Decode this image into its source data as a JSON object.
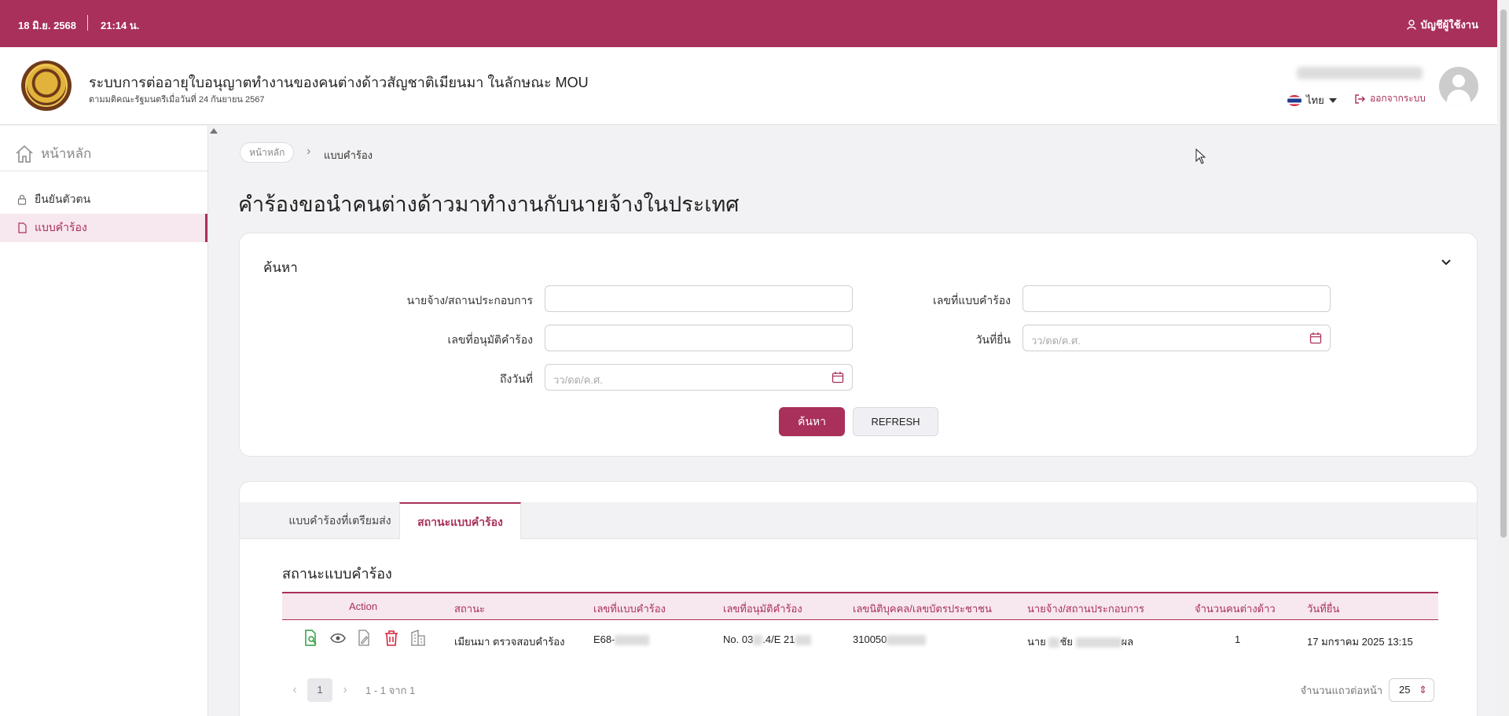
{
  "topbar": {
    "date": "18 มิ.ย. 2568",
    "time": "21:14 น.",
    "account_label": "บัญชีผู้ใช้งาน"
  },
  "header": {
    "title": "ระบบการต่ออายุใบอนุญาตทำงานของคนต่างด้าวสัญชาติเมียนมา ในลักษณะ MOU",
    "subtitle": "ตามมติคณะรัฐมนตรีเมื่อวันที่ 24 กันยายน 2567",
    "language": "ไทย",
    "logout": "ออกจากระบบ"
  },
  "sidebar": {
    "home": "หน้าหลัก",
    "items": [
      {
        "label": "ยืนยันตัวตน",
        "icon": "lock-icon"
      },
      {
        "label": "แบบคำร้อง",
        "icon": "document-icon"
      }
    ]
  },
  "breadcrumb": {
    "home": "หน้าหลัก",
    "current": "แบบคำร้อง"
  },
  "page_title": "คำร้องขอนำคนต่างด้าวมาทำงานกับนายจ้างในประเทศ",
  "search": {
    "title": "ค้นหา",
    "fields": {
      "employer": {
        "label": "นายจ้าง/สถานประกอบการ",
        "value": ""
      },
      "request_no": {
        "label": "เลขที่แบบคำร้อง",
        "value": ""
      },
      "approval_no": {
        "label": "เลขที่อนุมัติคำร้อง",
        "value": ""
      },
      "submit_date": {
        "label": "วันที่ยื่น",
        "placeholder": "วว/ดด/ค.ศ."
      },
      "to_date": {
        "label": "ถึงวันที่",
        "placeholder": "วว/ดด/ค.ศ."
      }
    },
    "search_button": "ค้นหา",
    "refresh_button": "REFRESH"
  },
  "tabs": [
    {
      "label": "แบบคำร้องที่เตรียมส่ง"
    },
    {
      "label": "สถานะแบบคำร้อง"
    }
  ],
  "table": {
    "title": "สถานะแบบคำร้อง",
    "columns": [
      "Action",
      "สถานะ",
      "เลขที่แบบคำร้อง",
      "เลขที่อนุมัติคำร้อง",
      "เลขนิติบุคคล/เลขบัตรประชาชน",
      "นายจ้าง/สถานประกอบการ",
      "จำนวนคนต่างด้าว",
      "วันที่ยื่น"
    ],
    "rows": [
      {
        "status": "เมียนมา ตรวจสอบคำร้อง",
        "request_no": "E68-",
        "approval_no_a": "No. 03",
        "approval_no_b": ".4/E 21",
        "juristic_id": "310050",
        "employer_a": "นาย",
        "employer_b": "ชัย",
        "employer_c": "ผล",
        "worker_count": "1",
        "submit_date": "17 มกราคม 2025 13:15"
      }
    ]
  },
  "pagination": {
    "page": "1",
    "info": "1 - 1 จาก 1",
    "rows_label": "จำนวนแถวต่อหน้า",
    "rows_value": "25"
  },
  "colors": {
    "brand": "#a8305b",
    "brand_light": "#f7e7ee",
    "action_green": "#2e9e3e",
    "action_red": "#d6253b"
  }
}
